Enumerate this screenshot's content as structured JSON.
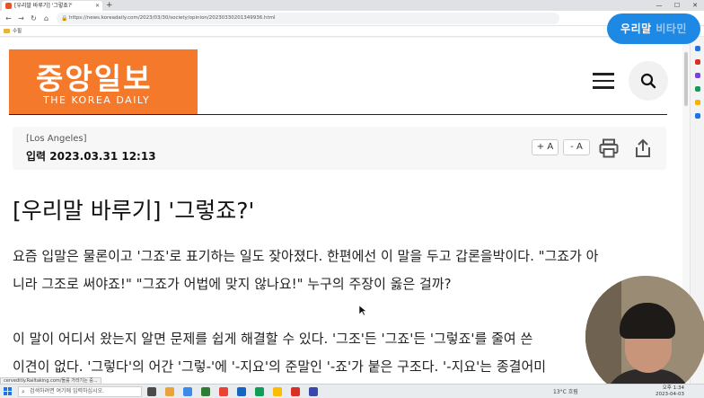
{
  "browser": {
    "tab_title": "[우리말 바루기] '그렇죠?'",
    "new_tab": "+",
    "url": "https://news.koreadaily.com/2023/03/30/society/opinion/20230330201349936.html",
    "bookmark_folder": "수필",
    "status_url": "cerveditly.Railtaking.com/돌를 가라기는 중..."
  },
  "overlay": {
    "badge_main": "우리말 ",
    "badge_dim": "비타민"
  },
  "site": {
    "logo_ko": "중앙일보",
    "logo_en": "THE KOREA DAILY",
    "menu_icon": "hamburger-icon",
    "search_icon": "search-icon"
  },
  "article": {
    "location": "[Los Angeles]",
    "date_label": "입력 2023.03.31 12:13",
    "font_increase": "+ A",
    "font_decrease": "- A",
    "print_icon": "print-icon",
    "share_icon": "share-icon",
    "headline": "[우리말 바루기] '그렇죠?'",
    "paragraphs": [
      "요즘 입말은 물론이고 '그죠'로 표기하는 일도 잦아졌다. 한편에선 이 말을 두고 갑론을박이다. \"그죠가 아",
      "니라 그조로 써야죠!\" \"그죠가 어법에 맞지 않나요!\" 누구의 주장이 옳은 걸까?",
      "이 말이 어디서 왔는지 알면 문제를 쉽게 해결할 수 있다. '그조'든 '그죠'든 '그렇죠'를 줄여 쓴",
      "이견이 없다. '그렇다'의 어간 '그렇-'에 '-지요'의 준말인 '-죠'가 붙은 구조다. '-지요'는 종결어미"
    ]
  },
  "taskbar": {
    "search_placeholder": "검색하려면 여기에 입력하십시오.",
    "weather": "13°C 흐림",
    "time": "오후 1:34",
    "date": "2023-04-03"
  },
  "colors": {
    "brand": "#f4792a",
    "badge": "#1e88e5"
  }
}
